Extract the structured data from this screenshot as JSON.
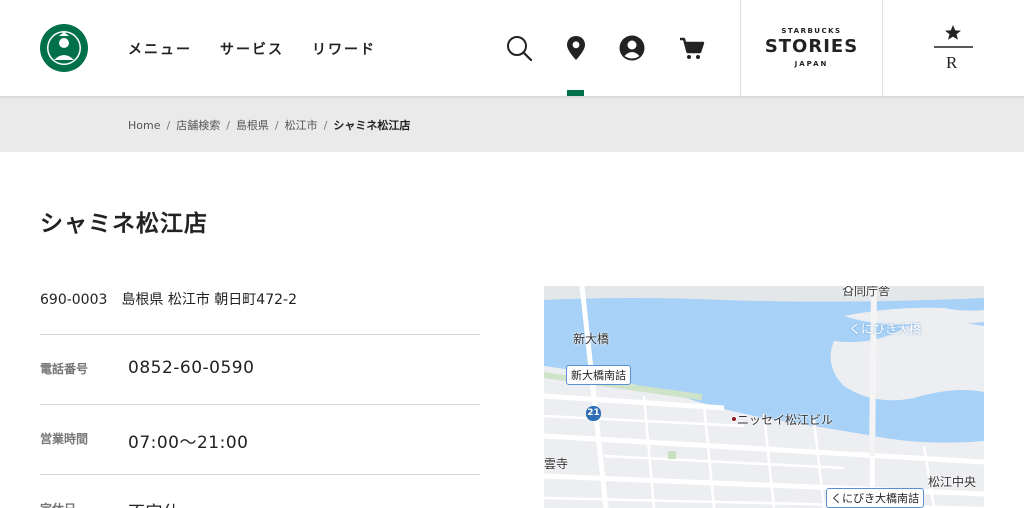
{
  "header": {
    "nav": [
      "メニュー",
      "サービス",
      "リワード"
    ],
    "icons": [
      "search-icon",
      "location-pin-icon",
      "account-icon",
      "cart-icon"
    ],
    "stories": {
      "top": "STARBUCKS",
      "main": "STORIES",
      "bottom": "JAPAN"
    },
    "reserve_mark": "R"
  },
  "breadcrumb": [
    "Home",
    "店舗検索",
    "島根県",
    "松江市",
    "シャミネ松江店"
  ],
  "store": {
    "name": "シャミネ松江店",
    "zip": "690-0003",
    "address": "島根県 松江市 朝日町472-2",
    "rows": [
      {
        "label": "電話番号",
        "value": "0852-60-0590"
      },
      {
        "label": "営業時間",
        "value": "07:00〜21:00"
      },
      {
        "label": "定休日",
        "value": "不定休"
      }
    ]
  },
  "map": {
    "labels": [
      "合同庁舎",
      "新大橋",
      "くにびき大橋",
      "ニッセイ松江ビル",
      "雲寺",
      "松江中央"
    ],
    "badges": [
      "新大橋南詰",
      "くにびき大橋南詰"
    ],
    "route": "21"
  },
  "colors": {
    "brand_green": "#00704a",
    "water": "#a8d1f7",
    "crumb_bg": "#eaeaea"
  }
}
